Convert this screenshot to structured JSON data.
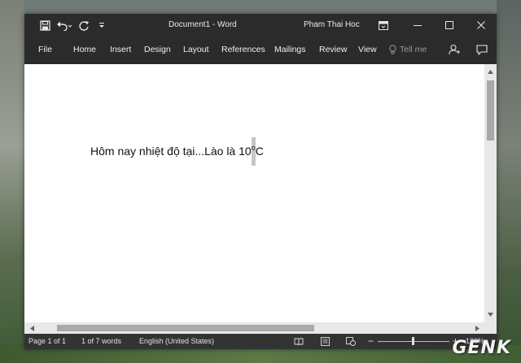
{
  "window": {
    "document_title": "Document1  -  Word",
    "user_name": "Pham Thai Hoc"
  },
  "ribbon": {
    "tabs": [
      "File",
      "Home",
      "Insert",
      "Design",
      "Layout",
      "References",
      "Mailings",
      "Review",
      "View"
    ],
    "tell_me_placeholder": "Tell me"
  },
  "document": {
    "text_main": "Hôm nay nhiệt độ tại...Lào là 10",
    "text_degree": "o",
    "text_unit": "C"
  },
  "status_bar": {
    "page": "Page 1 of 1",
    "words": "1 of 7 words",
    "language": "English (United States)",
    "zoom": "130%"
  },
  "icons": {
    "save": "save-icon",
    "undo": "undo-icon",
    "redo": "redo-icon",
    "customize": "customize-qat-icon",
    "ribbon_display": "ribbon-display-options-icon",
    "minimize": "minimize-icon",
    "maximize": "maximize-icon",
    "close": "close-icon",
    "tell_me": "lightbulb-icon",
    "share": "share-icon",
    "comments": "comments-icon"
  },
  "colors": {
    "titlebar": "#2b2b2b",
    "statusbar": "#333333",
    "page": "#ffffff",
    "selection": "#c6c6c6"
  },
  "watermark": "GENK"
}
